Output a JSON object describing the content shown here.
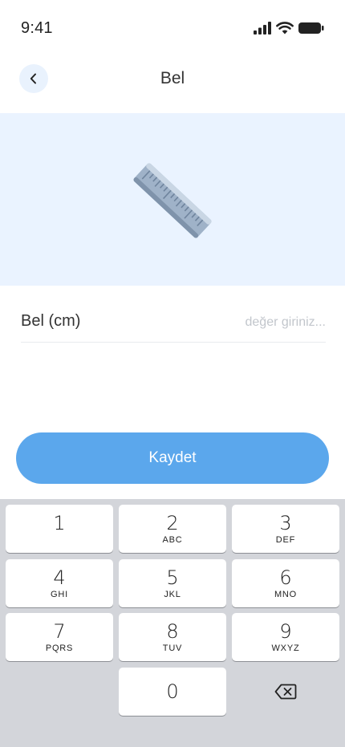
{
  "status_bar": {
    "time": "9:41"
  },
  "nav": {
    "title": "Bel"
  },
  "form": {
    "label": "Bel (cm)",
    "placeholder": "değer giriniz...",
    "value": ""
  },
  "save_button": {
    "label": "Kaydet"
  },
  "colors": {
    "accent": "#5ba7ec",
    "hero_bg": "#eaf3ff",
    "keyboard_bg": "#d3d5da"
  },
  "keyboard": {
    "keys": [
      {
        "digit": "1",
        "letters": ""
      },
      {
        "digit": "2",
        "letters": "ABC"
      },
      {
        "digit": "3",
        "letters": "DEF"
      },
      {
        "digit": "4",
        "letters": "GHI"
      },
      {
        "digit": "5",
        "letters": "JKL"
      },
      {
        "digit": "6",
        "letters": "MNO"
      },
      {
        "digit": "7",
        "letters": "PQRS"
      },
      {
        "digit": "8",
        "letters": "TUV"
      },
      {
        "digit": "9",
        "letters": "WXYZ"
      },
      {
        "digit": "0",
        "letters": ""
      }
    ],
    "delete_icon": "backspace-icon"
  }
}
